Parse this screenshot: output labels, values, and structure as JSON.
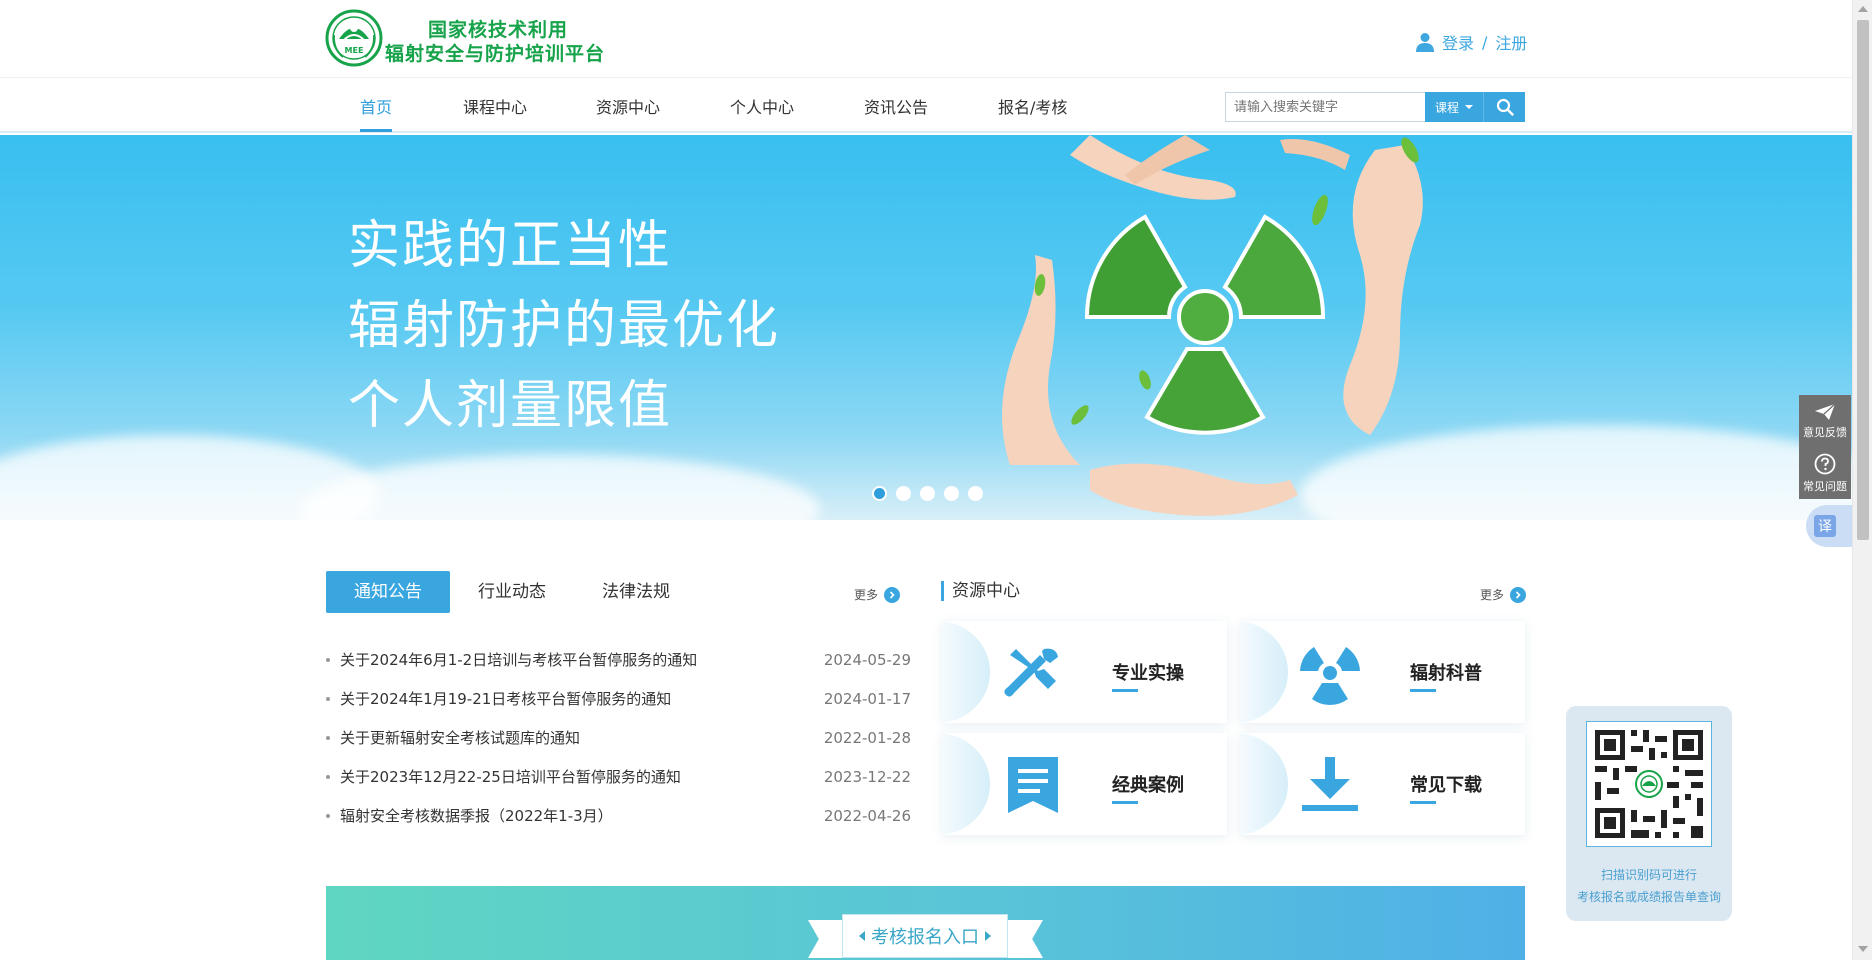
{
  "header": {
    "logo_badge_text": "MEE",
    "logo_line1": "国家核技术利用",
    "logo_line2": "辐射安全与防护培训平台",
    "login": "登录",
    "separator": "/",
    "register": "注册"
  },
  "nav": {
    "items": [
      {
        "label": "首页",
        "active": true
      },
      {
        "label": "课程中心"
      },
      {
        "label": "资源中心"
      },
      {
        "label": "个人中心"
      },
      {
        "label": "资讯公告"
      },
      {
        "label": "报名/考核"
      }
    ]
  },
  "search": {
    "placeholder": "请输入搜索关键字",
    "type_label": "课程",
    "icon": "search-icon"
  },
  "banner": {
    "lines": [
      "实践的正当性",
      "辐射防护的最优化",
      "个人剂量限值"
    ],
    "slide_count": 5,
    "active_slide": 1,
    "colors": {
      "sky_top": "#39bff0",
      "accent": "#2f9fdc"
    }
  },
  "news": {
    "tabs": [
      {
        "label": "通知公告",
        "active": true
      },
      {
        "label": "行业动态"
      },
      {
        "label": "法律法规"
      }
    ],
    "more": "更多",
    "items": [
      {
        "title": "关于2024年6月1-2日培训与考核平台暂停服务的通知",
        "date": "2024-05-29"
      },
      {
        "title": "关于2024年1月19-21日考核平台暂停服务的通知",
        "date": "2024-01-17"
      },
      {
        "title": "关于更新辐射安全考核试题库的通知",
        "date": "2022-01-28"
      },
      {
        "title": "关于2023年12月22-25日培训平台暂停服务的通知",
        "date": "2023-12-22"
      },
      {
        "title": "辐射安全考核数据季报（2022年1-3月）",
        "date": "2022-04-26"
      }
    ]
  },
  "resources": {
    "title": "资源中心",
    "more": "更多",
    "cards": [
      {
        "label": "专业实操",
        "icon": "tools-icon"
      },
      {
        "label": "辐射科普",
        "icon": "radiation-icon"
      },
      {
        "label": "经典案例",
        "icon": "document-bookmark-icon"
      },
      {
        "label": "常见下载",
        "icon": "download-icon"
      }
    ]
  },
  "exam_banner": {
    "label": "考核报名入口"
  },
  "side": {
    "feedback": "意见反馈",
    "faq": "常见问题",
    "translate": "译",
    "qr_line1": "扫描识别码可进行",
    "qr_line2": "考核报名或成绩报告单查询"
  }
}
